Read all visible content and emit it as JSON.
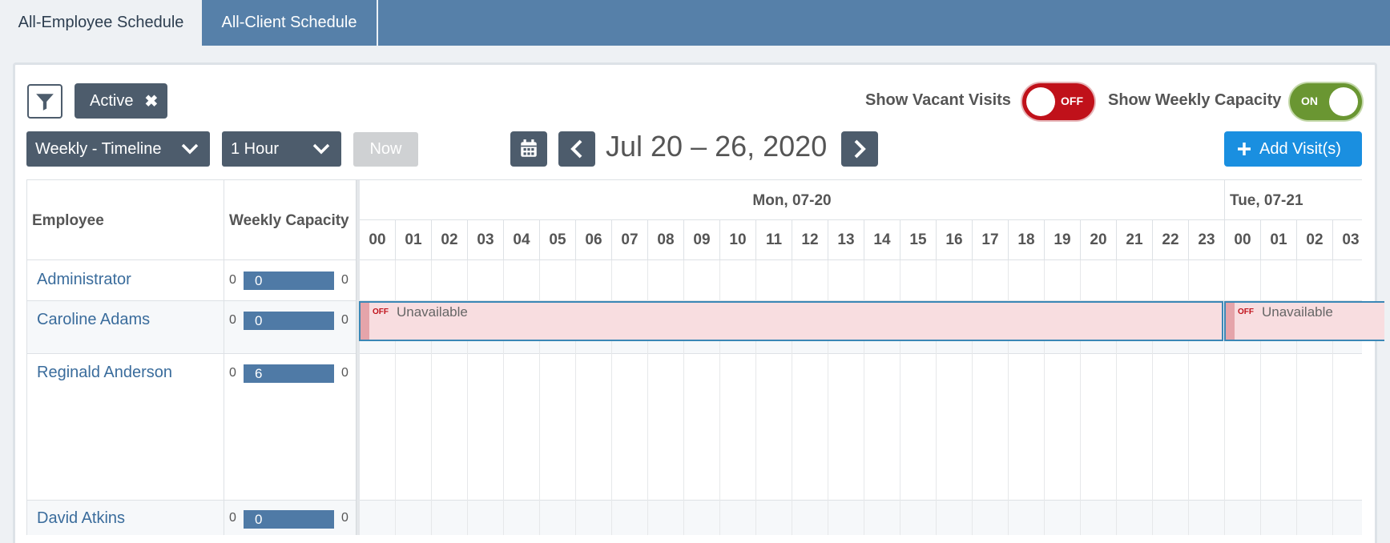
{
  "tabs": [
    {
      "label": "All-Employee Schedule",
      "active": true
    },
    {
      "label": "All-Client Schedule",
      "active": false
    }
  ],
  "filter": {
    "icon": "filter-icon",
    "active_chip_label": "Active"
  },
  "toggles": {
    "vacant": {
      "label": "Show Vacant Visits",
      "state": "OFF"
    },
    "capacity": {
      "label": "Show Weekly Capacity",
      "state": "ON"
    }
  },
  "controls": {
    "view": "Weekly - Timeline",
    "interval": "1 Hour",
    "now_label": "Now",
    "date_range": "Jul 20 – 26, 2020",
    "add_label": "Add Visit(s)"
  },
  "columns": {
    "employee": "Employee",
    "capacity": "Weekly Capacity"
  },
  "days": [
    "Mon, 07-20",
    "Tue, 07-21"
  ],
  "hours": [
    "00",
    "01",
    "02",
    "03",
    "04",
    "05",
    "06",
    "07",
    "08",
    "09",
    "10",
    "11",
    "12",
    "13",
    "14",
    "15",
    "16",
    "17",
    "18",
    "19",
    "20",
    "21",
    "22",
    "23",
    "00",
    "01",
    "02",
    "03"
  ],
  "employees": [
    {
      "name": "Administrator",
      "min": "0",
      "capacity": "0",
      "max": "0"
    },
    {
      "name": "Caroline Adams",
      "min": "0",
      "capacity": "0",
      "max": "0"
    },
    {
      "name": "Reginald Anderson",
      "min": "0",
      "capacity": "6",
      "max": "0"
    },
    {
      "name": "David Atkins",
      "min": "0",
      "capacity": "0",
      "max": "0"
    }
  ],
  "events": {
    "off_label": "OFF",
    "unavailable_label": "Unavailable"
  },
  "colors": {
    "header": "#5680a9",
    "dark_button": "#4d5c6c",
    "accent": "#1a8fe0",
    "off_toggle": "#c0111a",
    "on_toggle": "#6a9632",
    "unavailable_bg": "#f8dde0"
  }
}
